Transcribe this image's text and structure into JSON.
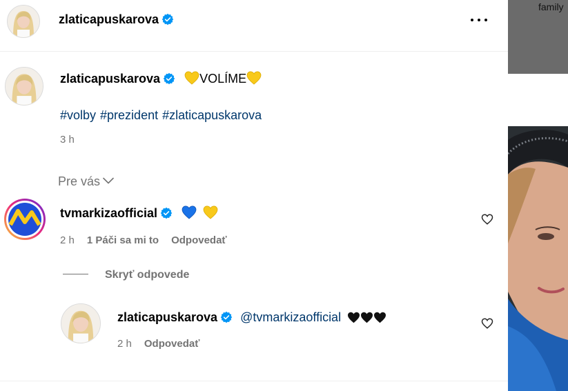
{
  "post_header": {
    "username": "zlaticapuskarova",
    "verified": true,
    "more_icon": "more-horizontal-icon"
  },
  "caption": {
    "username": "zlaticapuskarova",
    "text": "VOLÍME",
    "emojis": [
      "yellow-heart",
      "yellow-heart"
    ],
    "hashtags": [
      "#volby",
      "#prezident",
      "#zlaticapuskarova"
    ],
    "time": "3 h"
  },
  "sort": {
    "label": "Pre vás",
    "icon": "chevron-down-icon"
  },
  "comments": [
    {
      "username": "tvmarkizaofficial",
      "verified": true,
      "emojis": [
        "blue-heart",
        "yellow-heart"
      ],
      "time": "2 h",
      "likes": "1 Páči sa mi to",
      "reply_label": "Odpovedať",
      "hide_replies_label": "Skryť odpovede",
      "replies": [
        {
          "username": "zlaticapuskarova",
          "verified": true,
          "mention": "@tvmarkizaofficial",
          "emojis": [
            "black-heart",
            "black-heart",
            "black-heart"
          ],
          "time": "2 h",
          "reply_label": "Odpovedať"
        }
      ]
    }
  ],
  "side_panel": {
    "top_label": "family"
  },
  "colors": {
    "verified_blue": "#0095f6",
    "hashtag_blue": "#00376b",
    "meta_gray": "#737373",
    "yellow_heart": "#f8c91b",
    "blue_heart": "#1a73e8"
  }
}
